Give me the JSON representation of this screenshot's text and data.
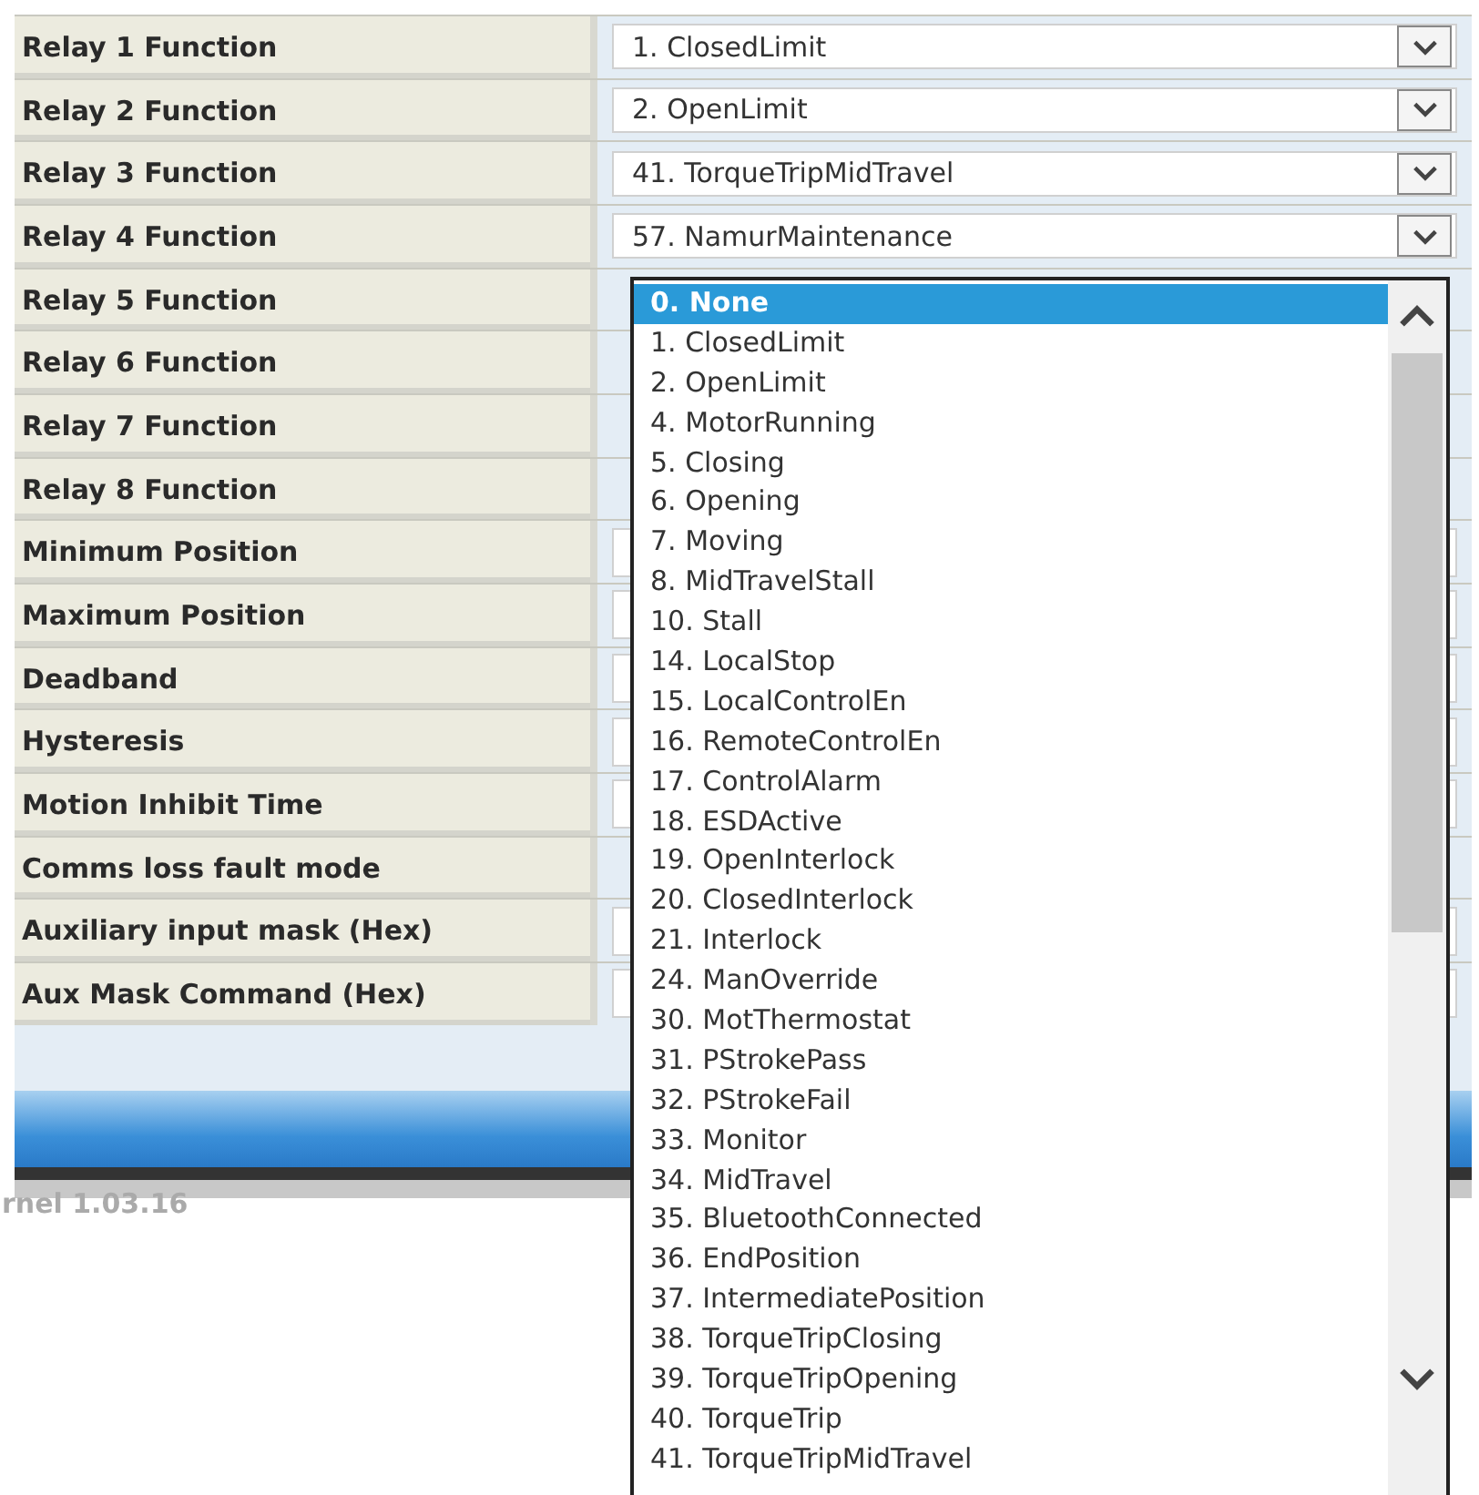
{
  "settings": [
    {
      "label": "Relay 1 Function",
      "kind": "select",
      "value": "1. ClosedLimit"
    },
    {
      "label": "Relay 2 Function",
      "kind": "select",
      "value": "2. OpenLimit"
    },
    {
      "label": "Relay 3 Function",
      "kind": "select",
      "value": "41. TorqueTripMidTravel"
    },
    {
      "label": "Relay 4 Function",
      "kind": "select",
      "value": "57. NamurMaintenance"
    },
    {
      "label": "Relay 5 Function",
      "kind": "open"
    },
    {
      "label": "Relay 6 Function",
      "kind": "open"
    },
    {
      "label": "Relay 7 Function",
      "kind": "open"
    },
    {
      "label": "Relay 8 Function",
      "kind": "open"
    },
    {
      "label": "Minimum Position",
      "kind": "input"
    },
    {
      "label": "Maximum Position",
      "kind": "input"
    },
    {
      "label": "Deadband",
      "kind": "input"
    },
    {
      "label": "Hysteresis",
      "kind": "input"
    },
    {
      "label": "Motion Inhibit Time",
      "kind": "input"
    },
    {
      "label": "Comms loss fault mode",
      "kind": "open"
    },
    {
      "label": "Auxiliary input mask (Hex)",
      "kind": "input"
    },
    {
      "label": "Aux Mask Command (Hex)",
      "kind": "input"
    }
  ],
  "dropdown": {
    "options": [
      {
        "label": "0. None",
        "selected": true
      },
      {
        "label": "1. ClosedLimit",
        "selected": false
      },
      {
        "label": "2. OpenLimit",
        "selected": false
      },
      {
        "label": "4. MotorRunning",
        "selected": false
      },
      {
        "label": "5. Closing",
        "selected": false
      },
      {
        "label": "6. Opening",
        "selected": false
      },
      {
        "label": "7. Moving",
        "selected": false
      },
      {
        "label": "8. MidTravelStall",
        "selected": false
      },
      {
        "label": "10. Stall",
        "selected": false
      },
      {
        "label": "14. LocalStop",
        "selected": false
      },
      {
        "label": "15. LocalControlEn",
        "selected": false
      },
      {
        "label": "16. RemoteControlEn",
        "selected": false
      },
      {
        "label": "17. ControlAlarm",
        "selected": false
      },
      {
        "label": "18. ESDActive",
        "selected": false
      },
      {
        "label": "19. OpenInterlock",
        "selected": false
      },
      {
        "label": "20. ClosedInterlock",
        "selected": false
      },
      {
        "label": "21. Interlock",
        "selected": false
      },
      {
        "label": "24. ManOverride",
        "selected": false
      },
      {
        "label": "30. MotThermostat",
        "selected": false
      },
      {
        "label": "31. PStrokePass",
        "selected": false
      },
      {
        "label": "32. PStrokeFail",
        "selected": false
      },
      {
        "label": "33. Monitor",
        "selected": false
      },
      {
        "label": "34. MidTravel",
        "selected": false
      },
      {
        "label": "35. BluetoothConnected",
        "selected": false
      },
      {
        "label": "36. EndPosition",
        "selected": false
      },
      {
        "label": "37. IntermediatePosition",
        "selected": false
      },
      {
        "label": "38. TorqueTripClosing",
        "selected": false
      },
      {
        "label": "39. TorqueTripOpening",
        "selected": false
      },
      {
        "label": "40. TorqueTrip",
        "selected": false
      },
      {
        "label": "41. TorqueTripMidTravel",
        "selected": false
      }
    ]
  },
  "footer": {
    "version": "rnel 1.03.16"
  }
}
